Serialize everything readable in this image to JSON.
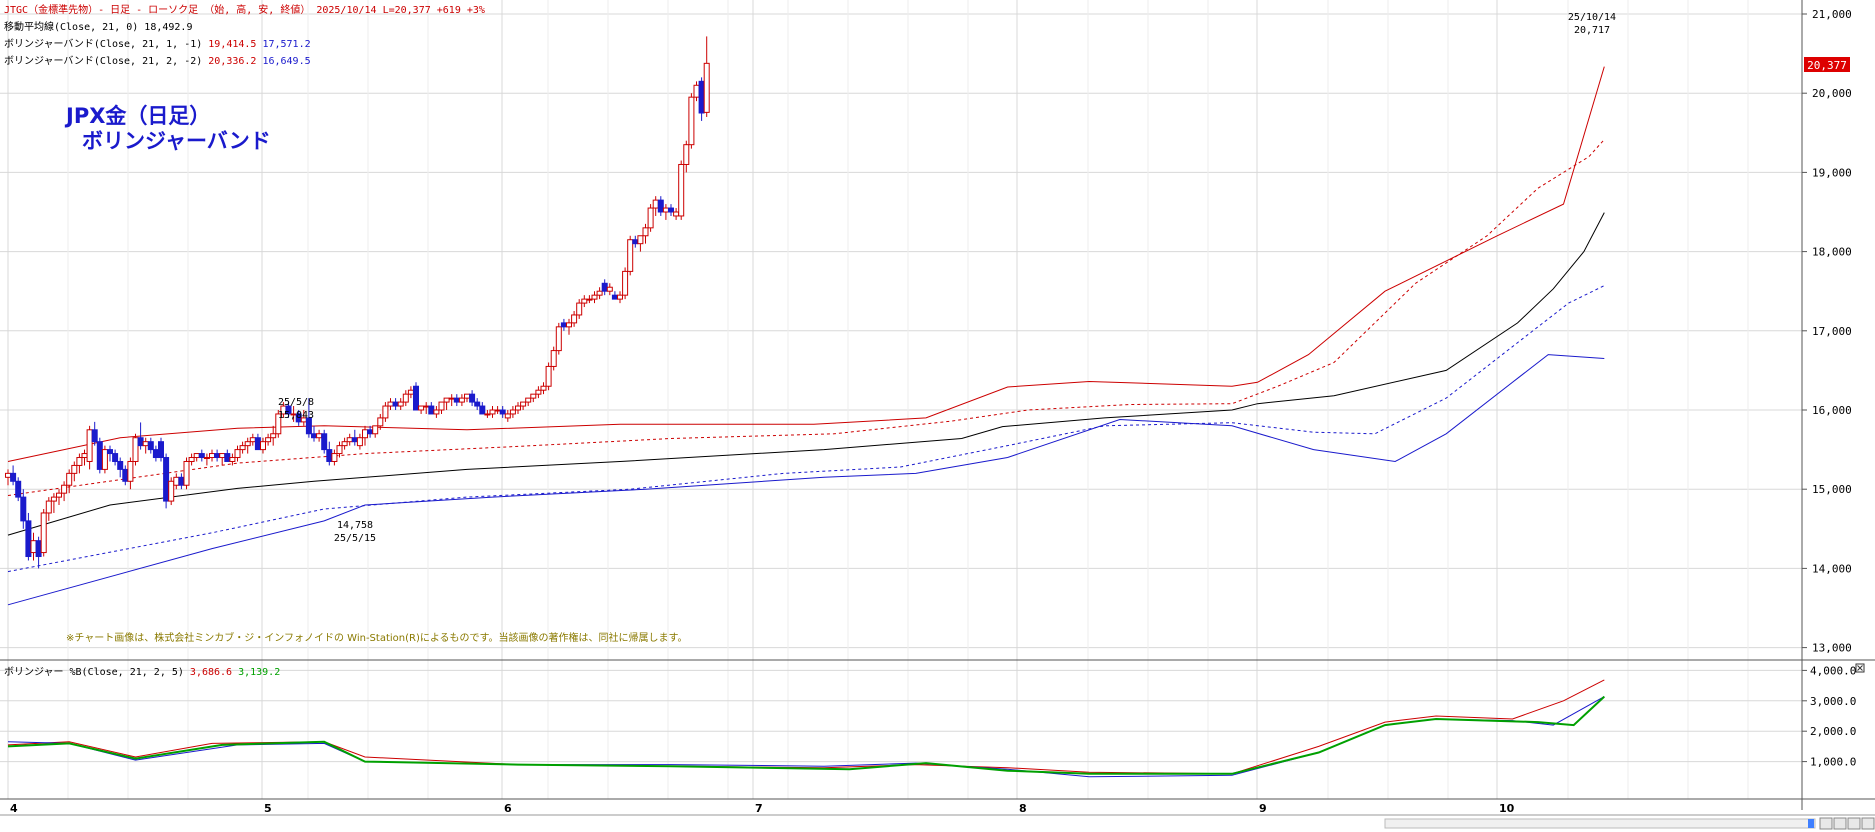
{
  "header": {
    "title": "JTGC（金標準先物）- 日足 - ローソク足 （始, 高, 安, 終値） 2025/10/14 L=20,377 +619 +3%",
    "ma_label": "移動平均線(Close, 21, 0)",
    "ma_value": "18,492.9",
    "bb1_label": "ボリンジャーバンド(Close, 21, 1, -1)",
    "bb1_up": "19,414.5",
    "bb1_lo": "17,571.2",
    "bb2_label": "ボリンジャーバンド(Close, 21, 2, -2)",
    "bb2_up": "20,336.2",
    "bb2_lo": "16,649.5"
  },
  "overlay": {
    "line1": "JPX金（日足）",
    "line2": "ボリンジャーバンド"
  },
  "notice": "※チャート画像は、株式会社ミンカブ・ジ・インフォノイドの Win-Station(R)によるものです。当該画像の著作権は、同社に帰属します。",
  "annotations": {
    "high1_date": "25/5/8",
    "high1_value": "15,843",
    "low1_value": "14,758",
    "low1_date": "25/5/15",
    "high2_date": "25/10/14",
    "high2_value": "20,717"
  },
  "price_label": "20,377",
  "sub": {
    "label": "ボリンジャー %B(Close, 21, 2, 5)",
    "v1": "3,686.6",
    "v2": "3,139.2"
  },
  "colors": {
    "up": "#cc0000",
    "down": "#1a1acc",
    "bb2": "#cc0000",
    "bb1": "#cc0000",
    "lower": "#1a1acc",
    "ma": "#000000",
    "green": "#00a000"
  },
  "chart_data": {
    "type": "candlestick",
    "x_labels": [
      "4",
      "5",
      "6",
      "7",
      "8",
      "9",
      "10"
    ],
    "y_ticks": [
      "13,000",
      "14,000",
      "15,000",
      "16,000",
      "17,000",
      "18,000",
      "19,000",
      "20,000",
      "21,000"
    ],
    "y_range": [
      13000,
      21000
    ],
    "sub_ticks": [
      "1,000.0",
      "2,000.0",
      "3,000.0",
      "4,000.0"
    ],
    "sub_range": [
      0,
      4500
    ],
    "candles": [
      [
        15150,
        15250,
        15050,
        15200
      ],
      [
        15200,
        15300,
        15050,
        15100
      ],
      [
        15100,
        15150,
        14850,
        14900
      ],
      [
        14900,
        15000,
        14500,
        14600
      ],
      [
        14600,
        14700,
        14100,
        14150
      ],
      [
        14200,
        14450,
        14100,
        14350
      ],
      [
        14350,
        14400,
        14000,
        14150
      ],
      [
        14200,
        14750,
        14150,
        14700
      ],
      [
        14700,
        14900,
        14600,
        14850
      ],
      [
        14850,
        14950,
        14700,
        14900
      ],
      [
        14900,
        15000,
        14800,
        14950
      ],
      [
        14950,
        15100,
        14850,
        15050
      ],
      [
        15050,
        15250,
        14950,
        15200
      ],
      [
        15200,
        15350,
        15100,
        15300
      ],
      [
        15300,
        15450,
        15200,
        15400
      ],
      [
        15400,
        15500,
        15300,
        15450
      ],
      [
        15350,
        15800,
        15250,
        15750
      ],
      [
        15750,
        15850,
        15550,
        15600
      ],
      [
        15600,
        15650,
        15200,
        15250
      ],
      [
        15250,
        15550,
        15200,
        15500
      ],
      [
        15500,
        15550,
        15350,
        15450
      ],
      [
        15450,
        15500,
        15300,
        15350
      ],
      [
        15350,
        15400,
        15150,
        15250
      ],
      [
        15250,
        15300,
        15050,
        15100
      ],
      [
        15100,
        15400,
        15000,
        15350
      ],
      [
        15350,
        15700,
        15300,
        15650
      ],
      [
        15650,
        15843,
        15500,
        15550
      ],
      [
        15550,
        15650,
        15450,
        15600
      ],
      [
        15600,
        15650,
        15450,
        15500
      ],
      [
        15500,
        15550,
        15350,
        15400
      ],
      [
        15600,
        15650,
        15350,
        15400
      ],
      [
        15400,
        15450,
        14758,
        14850
      ],
      [
        14850,
        15150,
        14800,
        15100
      ],
      [
        15050,
        15200,
        15000,
        15150
      ],
      [
        15150,
        15200,
        15000,
        15050
      ],
      [
        15050,
        15400,
        15000,
        15350
      ],
      [
        15350,
        15450,
        15300,
        15400
      ],
      [
        15400,
        15450,
        15350,
        15450
      ],
      [
        15450,
        15500,
        15350,
        15400
      ],
      [
        15400,
        15450,
        15300,
        15400
      ],
      [
        15400,
        15500,
        15350,
        15450
      ],
      [
        15450,
        15500,
        15350,
        15400
      ],
      [
        15400,
        15450,
        15300,
        15450
      ],
      [
        15450,
        15500,
        15350,
        15350
      ],
      [
        15350,
        15450,
        15300,
        15400
      ],
      [
        15400,
        15550,
        15350,
        15500
      ],
      [
        15500,
        15600,
        15450,
        15550
      ],
      [
        15550,
        15650,
        15450,
        15600
      ],
      [
        15600,
        15700,
        15550,
        15650
      ],
      [
        15650,
        15700,
        15500,
        15500
      ],
      [
        15500,
        15650,
        15450,
        15600
      ],
      [
        15600,
        15700,
        15550,
        15650
      ],
      [
        15650,
        15800,
        15550,
        15700
      ],
      [
        15700,
        16000,
        15650,
        15950
      ],
      [
        15950,
        16100,
        15900,
        16050
      ],
      [
        16050,
        16100,
        15900,
        15950
      ],
      [
        15950,
        16050,
        15850,
        15950
      ],
      [
        15950,
        16000,
        15800,
        15850
      ],
      [
        15850,
        16000,
        15800,
        15900
      ],
      [
        15900,
        16150,
        15650,
        15700
      ],
      [
        15700,
        15800,
        15600,
        15650
      ],
      [
        15650,
        15750,
        15600,
        15700
      ],
      [
        15700,
        15750,
        15450,
        15500
      ],
      [
        15500,
        15600,
        15300,
        15350
      ],
      [
        15350,
        15500,
        15300,
        15450
      ],
      [
        15450,
        15600,
        15400,
        15550
      ],
      [
        15550,
        15650,
        15500,
        15600
      ],
      [
        15600,
        15700,
        15550,
        15650
      ],
      [
        15650,
        15750,
        15550,
        15600
      ],
      [
        15550,
        15700,
        15500,
        15650
      ],
      [
        15650,
        15800,
        15550,
        15750
      ],
      [
        15750,
        15800,
        15650,
        15700
      ],
      [
        15700,
        15800,
        15650,
        15800
      ],
      [
        15800,
        15950,
        15750,
        15900
      ],
      [
        15900,
        16100,
        15850,
        16050
      ],
      [
        16050,
        16150,
        16000,
        16100
      ],
      [
        16100,
        16150,
        16000,
        16050
      ],
      [
        16050,
        16150,
        16000,
        16100
      ],
      [
        16100,
        16250,
        16050,
        16200
      ],
      [
        16200,
        16300,
        16150,
        16250
      ],
      [
        16300,
        16350,
        16100,
        16000
      ],
      [
        16000,
        16050,
        15950,
        16050
      ],
      [
        16050,
        16100,
        15950,
        16050
      ],
      [
        16050,
        16100,
        15950,
        15950
      ],
      [
        15950,
        16050,
        15900,
        16000
      ],
      [
        16000,
        16100,
        15950,
        16100
      ],
      [
        16100,
        16150,
        16000,
        16150
      ],
      [
        16150,
        16200,
        16050,
        16150
      ],
      [
        16150,
        16200,
        16050,
        16100
      ],
      [
        16100,
        16200,
        16050,
        16150
      ],
      [
        16150,
        16200,
        16100,
        16200
      ],
      [
        16200,
        16250,
        16050,
        16100
      ],
      [
        16100,
        16150,
        16000,
        16050
      ],
      [
        16050,
        16100,
        15950,
        15950
      ],
      [
        15950,
        16000,
        15900,
        15950
      ],
      [
        15950,
        16050,
        15900,
        16000
      ],
      [
        16000,
        16050,
        15950,
        16000
      ],
      [
        16000,
        16050,
        15900,
        15950
      ],
      [
        15900,
        16000,
        15850,
        15950
      ],
      [
        15950,
        16050,
        15900,
        16000
      ],
      [
        16000,
        16100,
        15950,
        16050
      ],
      [
        16050,
        16100,
        16000,
        16100
      ],
      [
        16100,
        16150,
        16050,
        16150
      ],
      [
        16150,
        16200,
        16100,
        16200
      ],
      [
        16200,
        16300,
        16150,
        16250
      ],
      [
        16250,
        16350,
        16200,
        16300
      ],
      [
        16300,
        16600,
        16250,
        16550
      ],
      [
        16550,
        16800,
        16500,
        16750
      ],
      [
        16750,
        17100,
        16700,
        17050
      ],
      [
        17100,
        17150,
        17000,
        17050
      ],
      [
        17050,
        17150,
        16950,
        17100
      ],
      [
        17100,
        17250,
        17050,
        17200
      ],
      [
        17200,
        17400,
        17150,
        17350
      ],
      [
        17350,
        17450,
        17300,
        17400
      ],
      [
        17400,
        17450,
        17350,
        17400
      ],
      [
        17400,
        17500,
        17350,
        17450
      ],
      [
        17450,
        17550,
        17400,
        17500
      ],
      [
        17600,
        17650,
        17450,
        17500
      ],
      [
        17500,
        17600,
        17450,
        17550
      ],
      [
        17450,
        17500,
        17400,
        17400
      ],
      [
        17400,
        17500,
        17350,
        17450
      ],
      [
        17450,
        17800,
        17400,
        17750
      ],
      [
        17750,
        18200,
        17700,
        18150
      ],
      [
        18150,
        18200,
        18050,
        18100
      ],
      [
        18100,
        18200,
        18000,
        18200
      ],
      [
        18200,
        18350,
        18100,
        18300
      ],
      [
        18300,
        18600,
        18250,
        18550
      ],
      [
        18550,
        18700,
        18450,
        18650
      ],
      [
        18650,
        18700,
        18450,
        18500
      ],
      [
        18500,
        18600,
        18400,
        18550
      ],
      [
        18550,
        18600,
        18450,
        18500
      ],
      [
        18450,
        18550,
        18400,
        18500
      ],
      [
        18450,
        19150,
        18400,
        19100
      ],
      [
        19100,
        19400,
        19000,
        19350
      ],
      [
        19350,
        20000,
        19300,
        19950
      ],
      [
        19950,
        20150,
        19900,
        20100
      ],
      [
        20150,
        20200,
        19650,
        19750
      ],
      [
        19758,
        20717,
        19700,
        20377
      ]
    ],
    "ma": [
      [
        0,
        14420
      ],
      [
        20,
        14800
      ],
      [
        45,
        15010
      ],
      [
        60,
        15100
      ],
      [
        90,
        15250
      ],
      [
        120,
        15350
      ],
      [
        160,
        15500
      ],
      [
        187,
        15640
      ],
      [
        195,
        15790
      ],
      [
        215,
        15900
      ],
      [
        240,
        16000
      ],
      [
        245,
        16080
      ],
      [
        260,
        16180
      ],
      [
        282,
        16500
      ],
      [
        296,
        17100
      ],
      [
        303,
        17530
      ],
      [
        309,
        18000
      ],
      [
        313,
        18493
      ]
    ],
    "bb1_upper": [
      [
        0,
        14920
      ],
      [
        45,
        15330
      ],
      [
        70,
        15450
      ],
      [
        100,
        15540
      ],
      [
        130,
        15640
      ],
      [
        162,
        15700
      ],
      [
        185,
        15860
      ],
      [
        200,
        16000
      ],
      [
        220,
        16070
      ],
      [
        240,
        16080
      ],
      [
        249,
        16300
      ],
      [
        260,
        16600
      ],
      [
        276,
        17600
      ],
      [
        290,
        18200
      ],
      [
        300,
        18800
      ],
      [
        310,
        19200
      ],
      [
        313,
        19415
      ]
    ],
    "bb1_lower": [
      [
        0,
        13960
      ],
      [
        40,
        14450
      ],
      [
        62,
        14750
      ],
      [
        90,
        14900
      ],
      [
        122,
        15000
      ],
      [
        152,
        15200
      ],
      [
        175,
        15280
      ],
      [
        196,
        15550
      ],
      [
        215,
        15800
      ],
      [
        240,
        15840
      ],
      [
        256,
        15720
      ],
      [
        268,
        15700
      ],
      [
        282,
        16150
      ],
      [
        297,
        16900
      ],
      [
        306,
        17350
      ],
      [
        313,
        17571
      ]
    ],
    "bb2_upper": [
      [
        0,
        15350
      ],
      [
        22,
        15650
      ],
      [
        45,
        15770
      ],
      [
        62,
        15800
      ],
      [
        90,
        15750
      ],
      [
        120,
        15820
      ],
      [
        158,
        15820
      ],
      [
        180,
        15900
      ],
      [
        196,
        16290
      ],
      [
        212,
        16360
      ],
      [
        240,
        16300
      ],
      [
        245,
        16350
      ],
      [
        255,
        16700
      ],
      [
        270,
        17500
      ],
      [
        292,
        18200
      ],
      [
        305,
        18600
      ],
      [
        313,
        20336
      ]
    ],
    "bb2_lower": [
      [
        0,
        13540
      ],
      [
        40,
        14250
      ],
      [
        62,
        14600
      ],
      [
        70,
        14800
      ],
      [
        95,
        14900
      ],
      [
        125,
        15000
      ],
      [
        160,
        15150
      ],
      [
        178,
        15200
      ],
      [
        196,
        15400
      ],
      [
        218,
        15880
      ],
      [
        240,
        15800
      ],
      [
        256,
        15500
      ],
      [
        272,
        15350
      ],
      [
        282,
        15700
      ],
      [
        296,
        16400
      ],
      [
        302,
        16700
      ],
      [
        313,
        16650
      ]
    ],
    "pctb_red": [
      [
        0,
        1550
      ],
      [
        12,
        1650
      ],
      [
        25,
        1150
      ],
      [
        40,
        1600
      ],
      [
        62,
        1650
      ],
      [
        70,
        1150
      ],
      [
        100,
        900
      ],
      [
        130,
        850
      ],
      [
        160,
        800
      ],
      [
        178,
        900
      ],
      [
        196,
        800
      ],
      [
        212,
        650
      ],
      [
        240,
        600
      ],
      [
        257,
        1500
      ],
      [
        270,
        2300
      ],
      [
        280,
        2500
      ],
      [
        295,
        2400
      ],
      [
        305,
        3000
      ],
      [
        313,
        3687
      ]
    ],
    "pctb_blue": [
      [
        0,
        1650
      ],
      [
        12,
        1600
      ],
      [
        25,
        1050
      ],
      [
        45,
        1550
      ],
      [
        62,
        1600
      ],
      [
        70,
        1000
      ],
      [
        100,
        900
      ],
      [
        130,
        900
      ],
      [
        160,
        850
      ],
      [
        178,
        950
      ],
      [
        196,
        750
      ],
      [
        212,
        500
      ],
      [
        240,
        550
      ],
      [
        257,
        1300
      ],
      [
        270,
        2200
      ],
      [
        280,
        2400
      ],
      [
        295,
        2350
      ],
      [
        303,
        2200
      ],
      [
        313,
        3139
      ]
    ],
    "pctb_green": [
      [
        0,
        1500
      ],
      [
        12,
        1600
      ],
      [
        25,
        1100
      ],
      [
        42,
        1550
      ],
      [
        62,
        1650
      ],
      [
        70,
        1000
      ],
      [
        100,
        900
      ],
      [
        130,
        850
      ],
      [
        165,
        750
      ],
      [
        180,
        950
      ],
      [
        196,
        700
      ],
      [
        212,
        600
      ],
      [
        240,
        600
      ],
      [
        257,
        1300
      ],
      [
        270,
        2200
      ],
      [
        280,
        2400
      ],
      [
        300,
        2300
      ],
      [
        307,
        2200
      ],
      [
        313,
        3139
      ]
    ]
  }
}
